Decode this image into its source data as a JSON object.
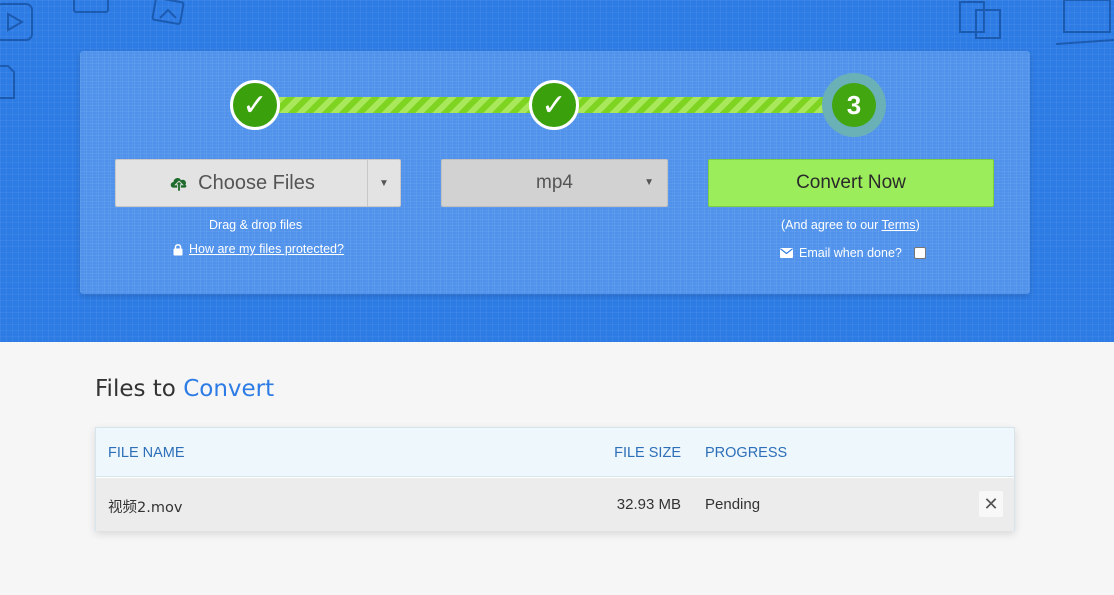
{
  "steps": [
    {
      "label": "✓"
    },
    {
      "label": "✓"
    },
    {
      "label": "3"
    }
  ],
  "upload": {
    "choose_label": "Choose Files",
    "drag_hint": "Drag & drop files",
    "protect_link": "How are my files protected?",
    "icon": "cloud-upload-icon"
  },
  "format": {
    "selected": "mp4"
  },
  "convert": {
    "button_label": "Convert Now",
    "agree_prefix": "(And agree to our ",
    "terms_link": "Terms",
    "agree_suffix": ")",
    "email_label": "Email when done?"
  },
  "files": {
    "title_prefix": "Files to ",
    "title_accent": "Convert",
    "columns": {
      "name": "FILE NAME",
      "size": "FILE SIZE",
      "progress": "PROGRESS"
    },
    "rows": [
      {
        "name": "视频2.mov",
        "size": "32.93 MB",
        "progress": "Pending"
      }
    ],
    "remove_label": "✕"
  },
  "colors": {
    "brand_blue": "#2d7be4",
    "step_green": "#3aa10c",
    "convert_green": "#9ced5b",
    "header_text": "#2d6fb8"
  }
}
